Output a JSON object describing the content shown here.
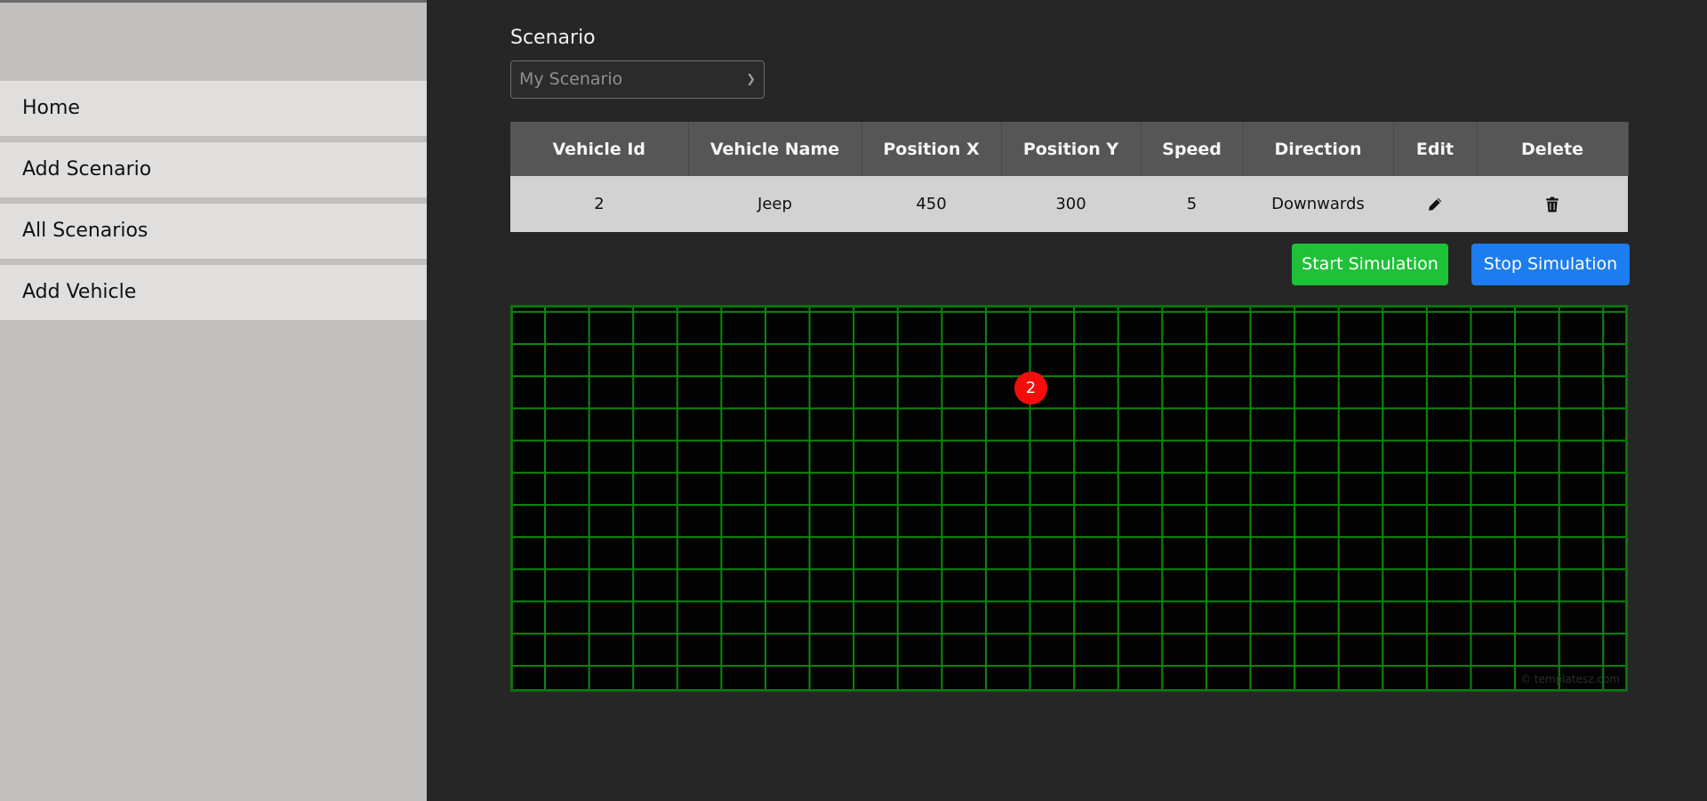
{
  "sidebar": {
    "items": [
      {
        "label": "Home"
      },
      {
        "label": "Add Scenario"
      },
      {
        "label": "All Scenarios"
      },
      {
        "label": "Add Vehicle"
      }
    ]
  },
  "scenario": {
    "label": "Scenario",
    "selected": "My Scenario"
  },
  "table": {
    "headers": [
      "Vehicle Id",
      "Vehicle Name",
      "Position X",
      "Position Y",
      "Speed",
      "Direction",
      "Edit",
      "Delete"
    ],
    "rows": [
      {
        "id": "2",
        "name": "Jeep",
        "pos_x": "450",
        "pos_y": "300",
        "speed": "5",
        "direction": "Downwards",
        "edit_icon": "pencil-icon",
        "delete_icon": "trash-icon"
      }
    ]
  },
  "actions": {
    "start_label": "Start Simulation",
    "stop_label": "Stop Simulation"
  },
  "grid": {
    "markers": [
      {
        "label": "2"
      }
    ],
    "watermark": "© templatesz.com"
  },
  "colors": {
    "start_button": "#1ec138",
    "stop_button": "#1c7cf0",
    "grid_line": "#0a8a0a",
    "marker": "#f40d0d"
  }
}
